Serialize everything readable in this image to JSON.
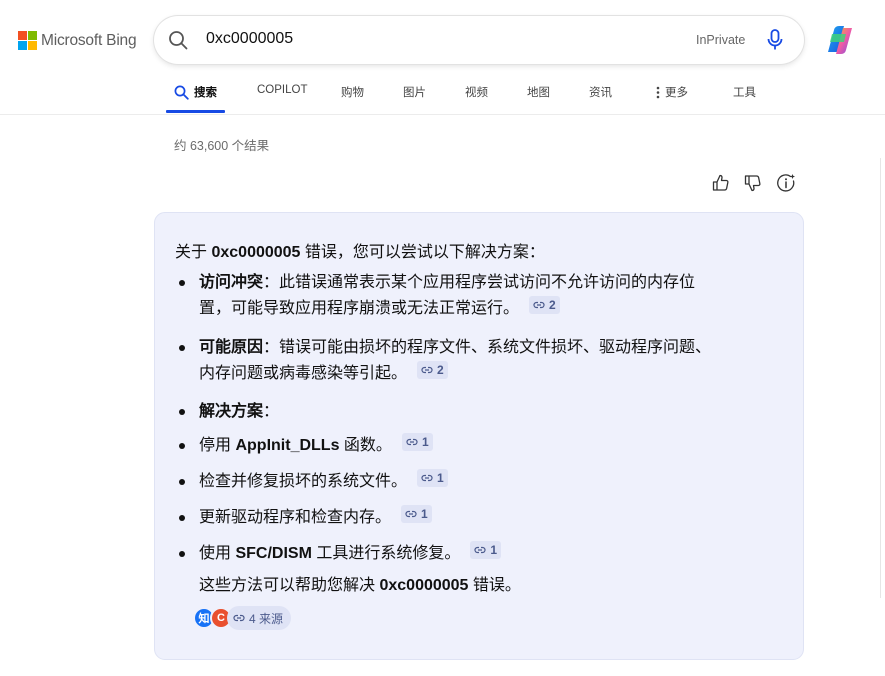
{
  "brand": {
    "logo_text": "Microsoft Bing"
  },
  "search": {
    "query": "0xc0000005",
    "inprivate_label": "InPrivate"
  },
  "tabs": [
    {
      "label": "搜索",
      "active": true,
      "icon": "search-icon"
    },
    {
      "label": "COPILOT"
    },
    {
      "label": "购物"
    },
    {
      "label": "图片"
    },
    {
      "label": "视频"
    },
    {
      "label": "地图"
    },
    {
      "label": "资讯"
    },
    {
      "label": "更多",
      "icon": "more-dots-icon"
    },
    {
      "label": "工具"
    }
  ],
  "results": {
    "count_text": "约 63,600 个结果"
  },
  "answer": {
    "intro_prefix": "关于",
    "intro_bold": "0xc0000005",
    "intro_suffix": "错误，您可以尝试以下解决方案：",
    "bullets": [
      {
        "bold": "访问冲突",
        "line1": "：此错误通常表示某个应用程序尝试访问不允许访问的内存位",
        "line2": "置，可能导致应用程序崩溃或无法正常运行。",
        "citation": "2"
      },
      {
        "bold": "可能原因",
        "line1": "：错误可能由损坏的程序文件、系统文件损坏、驱动程序问题、",
        "line2": "内存问题或病毒感染等引起。",
        "citation": "2"
      },
      {
        "bold": "解决方案",
        "line1": "："
      },
      {
        "prefix": "停用",
        "bold": "AppInit_DLLs",
        "suffix": "函数。",
        "citation": "1"
      },
      {
        "text": "检查并修复损坏的系统文件。",
        "citation": "1"
      },
      {
        "text": "更新驱动程序和检查内存。",
        "citation": "1"
      },
      {
        "prefix": "使用",
        "bold": "SFC/DISM",
        "suffix": "工具进行系统修复。",
        "citation": "1"
      }
    ],
    "summary_prefix": "这些方法可以帮助您解决",
    "summary_bold": "0xc0000005",
    "summary_suffix": "错误。",
    "sources": {
      "icon1_text": "知",
      "icon2_text": "C",
      "label": "4 来源"
    }
  },
  "colors": {
    "accent": "#174ae4",
    "card_bg": "#eff1fc",
    "citation_bg": "#dfe3f5"
  }
}
